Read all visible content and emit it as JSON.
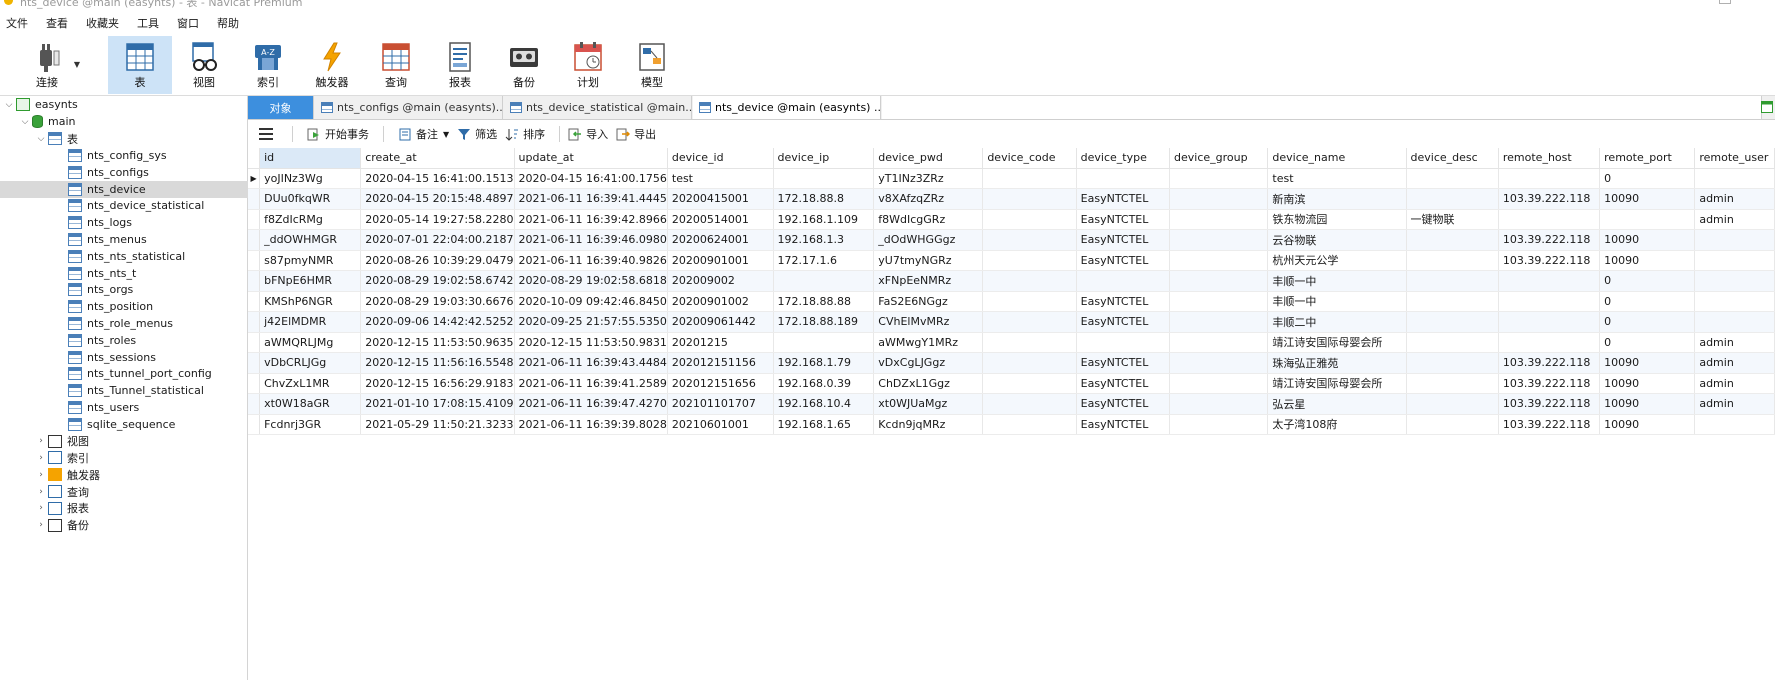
{
  "window": {
    "title": "nts_device @main (easynts) - 表 - Navicat Premium"
  },
  "menubar": {
    "items": [
      "文件",
      "查看",
      "收藏夹",
      "工具",
      "窗口",
      "帮助"
    ]
  },
  "toolbar": {
    "buttons": [
      {
        "label": "连接",
        "icon": "plug-icon"
      },
      {
        "label": "表",
        "icon": "table-icon"
      },
      {
        "label": "视图",
        "icon": "view-glasses-icon"
      },
      {
        "label": "索引",
        "icon": "index-az-icon"
      },
      {
        "label": "触发器",
        "icon": "lightning-icon"
      },
      {
        "label": "查询",
        "icon": "query-grid-icon"
      },
      {
        "label": "报表",
        "icon": "report-icon"
      },
      {
        "label": "备份",
        "icon": "backup-tape-icon"
      },
      {
        "label": "计划",
        "icon": "calendar-icon"
      },
      {
        "label": "模型",
        "icon": "model-icon"
      }
    ],
    "active": "表"
  },
  "sidebar": {
    "connection": "easynts",
    "database": "main",
    "tables_group": "表",
    "tables": [
      "nts_config_sys",
      "nts_configs",
      "nts_device",
      "nts_device_statistical",
      "nts_logs",
      "nts_menus",
      "nts_nts_statistical",
      "nts_nts_t",
      "nts_orgs",
      "nts_position",
      "nts_role_menus",
      "nts_roles",
      "nts_sessions",
      "nts_tunnel_port_config",
      "nts_Tunnel_statistical",
      "nts_users",
      "sqlite_sequence"
    ],
    "selected_table": "nts_device",
    "groups": [
      "视图",
      "索引",
      "触发器",
      "查询",
      "报表",
      "备份"
    ]
  },
  "tabs": {
    "objects": "对象",
    "items": [
      "nts_configs @main (easynts)...",
      "nts_device_statistical @main...",
      "nts_device @main (easynts) ..."
    ]
  },
  "subtoolbar": {
    "begin_transaction": "开始事务",
    "memo": "备注",
    "filter": "筛选",
    "sort": "排序",
    "import": "导入",
    "export": "导出"
  },
  "grid": {
    "columns": [
      "id",
      "create_at",
      "update_at",
      "device_id",
      "device_ip",
      "device_pwd",
      "device_code",
      "device_type",
      "device_group",
      "device_name",
      "device_desc",
      "remote_host",
      "remote_port",
      "remote_user"
    ],
    "rows": [
      [
        "yoJINz3Wg",
        "2020-04-15 16:41:00.1513",
        "2020-04-15 16:41:00.1756",
        "test",
        "",
        "yT1INz3ZRz",
        "",
        "",
        "",
        "test",
        "",
        "",
        "0",
        ""
      ],
      [
        "DUu0fkqWR",
        "2020-04-15 20:15:48.4897",
        "2021-06-11 16:39:41.4445",
        "20200415001",
        "172.18.88.8",
        "v8XAfzqZRz",
        "",
        "EasyNTCTEL",
        "",
        "新南滨",
        "",
        "103.39.222.118",
        "10090",
        "admin"
      ],
      [
        "f8ZdIcRMg",
        "2020-05-14 19:27:58.2280",
        "2021-06-11 16:39:42.8966",
        "20200514001",
        "192.168.1.109",
        "f8WdIcgGRz",
        "",
        "EasyNTCTEL",
        "",
        "铁东物流园",
        "一键物联",
        "",
        "",
        "admin"
      ],
      [
        "_ddOWHMGR",
        "2020-07-01 22:04:00.2187",
        "2021-06-11 16:39:46.0980",
        "20200624001",
        "192.168.1.3",
        "_dOdWHGGgz",
        "",
        "EasyNTCTEL",
        "",
        "云谷物联",
        "",
        "103.39.222.118",
        "10090",
        ""
      ],
      [
        "s87pmyNMR",
        "2020-08-26 10:39:29.0479",
        "2021-06-11 16:39:40.9826",
        "20200901001",
        "172.17.1.6",
        "yU7tmyNGRz",
        "",
        "EasyNTCTEL",
        "",
        "杭州天元公学",
        "",
        "103.39.222.118",
        "10090",
        ""
      ],
      [
        "bFNpE6HMR",
        "2020-08-29 19:02:58.6742",
        "2020-08-29 19:02:58.6818",
        "202009002",
        "",
        "xFNpEeNMRz",
        "",
        "",
        "",
        "丰顺一中",
        "",
        "",
        "0",
        ""
      ],
      [
        "KMShP6NGR",
        "2020-08-29 19:03:30.6676",
        "2020-10-09 09:42:46.8450",
        "20200901002",
        "172.18.88.88",
        "FaS2E6NGgz",
        "",
        "EasyNTCTEL",
        "",
        "丰顺一中",
        "",
        "",
        "0",
        ""
      ],
      [
        "j42ElMDMR",
        "2020-09-06 14:42:42.5252",
        "2020-09-25 21:57:55.5350",
        "202009061442",
        "172.18.88.189",
        "CVhElMvMRz",
        "",
        "EasyNTCTEL",
        "",
        "丰顺二中",
        "",
        "",
        "0",
        ""
      ],
      [
        "aWMQRLJMg",
        "2020-12-15 11:53:50.9635",
        "2020-12-15 11:53:50.9831",
        "20201215",
        "",
        "aWMwgY1MRz",
        "",
        "",
        "",
        "靖江诗安国际母婴会所",
        "",
        "",
        "0",
        "admin"
      ],
      [
        "vDbCRLJGg",
        "2020-12-15 11:56:16.5548",
        "2021-06-11 16:39:43.4484",
        "202012151156",
        "192.168.1.79",
        "vDxCgLJGgz",
        "",
        "EasyNTCTEL",
        "",
        "珠海弘正雅苑",
        "",
        "103.39.222.118",
        "10090",
        "admin"
      ],
      [
        "ChvZxL1MR",
        "2020-12-15 16:56:29.9183",
        "2021-06-11 16:39:41.2589",
        "202012151656",
        "192.168.0.39",
        "ChDZxL1Ggz",
        "",
        "EasyNTCTEL",
        "",
        "靖江诗安国际母婴会所",
        "",
        "103.39.222.118",
        "10090",
        "admin"
      ],
      [
        "xt0W18aGR",
        "2021-01-10 17:08:15.4109",
        "2021-06-11 16:39:47.4270",
        "202101101707",
        "192.168.10.4",
        "xt0WJUaMgz",
        "",
        "EasyNTCTEL",
        "",
        "弘云星",
        "",
        "103.39.222.118",
        "10090",
        "admin"
      ],
      [
        "Fcdnrj3GR",
        "2021-05-29 11:50:21.3233",
        "2021-06-11 16:39:39.8028",
        "20210601001",
        "192.168.1.65",
        "Kcdn9jqMRz",
        "",
        "EasyNTCTEL",
        "",
        "太子湾108府",
        "",
        "103.39.222.118",
        "10090",
        ""
      ]
    ],
    "current_row": 0
  },
  "colors": {
    "accent": "#3d8fde",
    "active_toolbar": "#cde3f7",
    "selected_row": "#d9d9d9"
  }
}
